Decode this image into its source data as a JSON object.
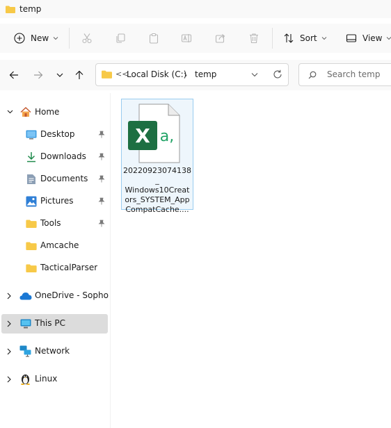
{
  "window": {
    "title": "temp"
  },
  "toolbar": {
    "new_label": "New",
    "sort_label": "Sort",
    "view_label": "View",
    "icons": [
      "plus-icon",
      "cut-icon",
      "copy-icon",
      "paste-icon",
      "rename-icon",
      "share-icon",
      "delete-icon",
      "sort-icon",
      "view-icon"
    ]
  },
  "address": {
    "overflow": "<<",
    "segments": [
      "Local Disk (C:)",
      "temp"
    ],
    "search_placeholder": "Search temp"
  },
  "sidebar": {
    "home": "Home",
    "quick_access": [
      {
        "label": "Desktop",
        "icon": "desktop-icon",
        "pinned": true
      },
      {
        "label": "Downloads",
        "icon": "download-icon",
        "pinned": true
      },
      {
        "label": "Documents",
        "icon": "documents-icon",
        "pinned": true
      },
      {
        "label": "Pictures",
        "icon": "pictures-icon",
        "pinned": true
      },
      {
        "label": "Tools",
        "icon": "folder-icon",
        "pinned": true
      },
      {
        "label": "Amcache",
        "icon": "folder-icon",
        "pinned": false
      },
      {
        "label": "TacticalParser",
        "icon": "folder-icon",
        "pinned": false
      }
    ],
    "onedrive": "OneDrive - Sophos L",
    "this_pc": "This PC",
    "network": "Network",
    "linux": "Linux",
    "selected": "This PC"
  },
  "files": [
    {
      "name_lines": [
        "20220923074138_",
        "Windows10Creat",
        "ors_SYSTEM_App",
        "CompatCache...."
      ],
      "type": "csv",
      "icon_letters": "X",
      "icon_suffix": "a,"
    }
  ],
  "colors": {
    "excel_green": "#1d6f42",
    "folder_yellow": "#f7c948",
    "selection_border": "#99ccf0",
    "selection_fill": "#eef6fc"
  }
}
